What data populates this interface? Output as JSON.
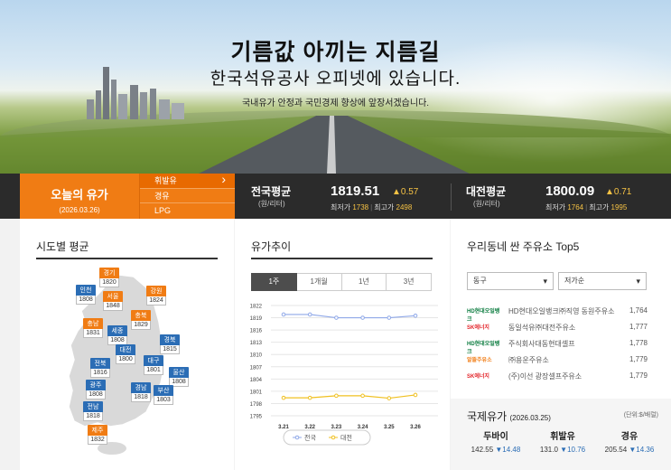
{
  "hero": {
    "title": "기름값 아끼는 지름길",
    "subtitle": "한국석유공사 오피넷에 있습니다.",
    "tagline": "국내유가 안정과 국민경제 향상에 앞장서겠습니다."
  },
  "today": {
    "label": "오늘의 유가",
    "date": "(2026.03.26)",
    "fuels": [
      "휘발유",
      "경유",
      "LPG"
    ],
    "active_fuel": "휘발유"
  },
  "national": {
    "name": "전국평균",
    "unit": "(원/리터)",
    "price": "1819.51",
    "change": "▲0.57",
    "min_label": "최저가",
    "min": "1738",
    "max_label": "최고가",
    "max": "2498"
  },
  "daejeon": {
    "name": "대전평균",
    "unit": "(원/리터)",
    "price": "1800.09",
    "change": "▲0.71",
    "min_label": "최저가",
    "min": "1764",
    "max_label": "최고가",
    "max": "1995"
  },
  "regional": {
    "title": "시도별 평균",
    "regions": [
      {
        "name": "경기",
        "value": "1820",
        "color": "orange"
      },
      {
        "name": "인천",
        "value": "1808",
        "color": "blue"
      },
      {
        "name": "서울",
        "value": "1848",
        "color": "orange"
      },
      {
        "name": "강원",
        "value": "1824",
        "color": "orange"
      },
      {
        "name": "충북",
        "value": "1829",
        "color": "orange"
      },
      {
        "name": "충남",
        "value": "1831",
        "color": "orange"
      },
      {
        "name": "세종",
        "value": "1808",
        "color": "blue"
      },
      {
        "name": "경북",
        "value": "1815",
        "color": "blue"
      },
      {
        "name": "대전",
        "value": "1800",
        "color": "blue"
      },
      {
        "name": "전북",
        "value": "1816",
        "color": "blue"
      },
      {
        "name": "대구",
        "value": "1801",
        "color": "blue"
      },
      {
        "name": "울산",
        "value": "1808",
        "color": "blue"
      },
      {
        "name": "광주",
        "value": "1808",
        "color": "blue"
      },
      {
        "name": "경남",
        "value": "1818",
        "color": "blue"
      },
      {
        "name": "부산",
        "value": "1803",
        "color": "blue"
      },
      {
        "name": "전남",
        "value": "1818",
        "color": "blue"
      },
      {
        "name": "제주",
        "value": "1832",
        "color": "orange"
      }
    ]
  },
  "trend": {
    "title": "유가추이",
    "tabs": [
      "1주",
      "1개월",
      "1년",
      "3년"
    ],
    "active_tab": "1주",
    "legend": [
      "전국",
      "대전"
    ]
  },
  "chart_data": {
    "type": "line",
    "x": [
      "3.21",
      "3.22",
      "3.23",
      "3.24",
      "3.25",
      "3.26"
    ],
    "series": [
      {
        "name": "전국",
        "values": [
          1819.8,
          1819.8,
          1819.0,
          1819.0,
          1819.0,
          1819.5
        ],
        "color": "#8fa8e8"
      },
      {
        "name": "대전",
        "values": [
          1799.4,
          1799.4,
          1799.9,
          1799.9,
          1799.3,
          1800.1
        ],
        "color": "#f0c020"
      }
    ],
    "yticks": [
      1795,
      1798,
      1801,
      1804,
      1807,
      1810,
      1813,
      1816,
      1819,
      1822
    ],
    "ylim": [
      1795,
      1822
    ],
    "grid": true,
    "legend_position": "bottom"
  },
  "top5": {
    "title": "우리동네 싼 주유소 Top5",
    "district": "동구",
    "sort": "저가순",
    "stations": [
      {
        "brand": "HD현대오일뱅크",
        "brand_color": "#0a7b3e",
        "name": "HD현대오일뱅크㈜직영 동원주유소",
        "price": "1,764"
      },
      {
        "brand": "SK에너지",
        "brand_color": "#e3262b",
        "name": "동일석유㈜대전주유소",
        "price": "1,777"
      },
      {
        "brand": "HD현대오일뱅크",
        "brand_color": "#0a7b3e",
        "name": "주식회사대동현대셀프",
        "price": "1,778"
      },
      {
        "brand": "알뜰주유소",
        "brand_color": "#f07c14",
        "name": "㈜용운주유소",
        "price": "1,779"
      },
      {
        "brand": "SK에너지",
        "brand_color": "#e3262b",
        "name": "(주)이선 광장셀프주유소",
        "price": "1,779"
      }
    ]
  },
  "intl": {
    "title": "국제유가",
    "date": "(2026.03.25)",
    "unit": "(단위:$/배럴)",
    "items": [
      {
        "name": "두바이",
        "value": "142.55",
        "change": "▼14.48"
      },
      {
        "name": "휘발유",
        "value": "131.0",
        "change": "▼10.76"
      },
      {
        "name": "경유",
        "value": "205.54",
        "change": "▼14.36"
      }
    ]
  }
}
